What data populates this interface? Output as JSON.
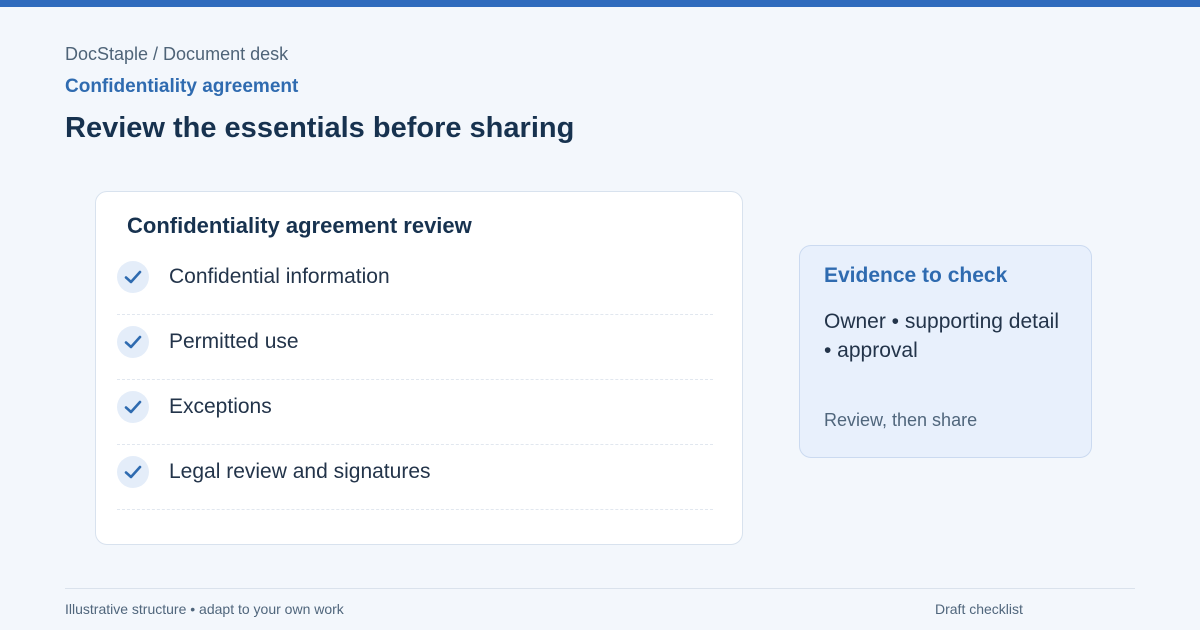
{
  "header": {
    "breadcrumb": "DocStaple / Document desk",
    "document_name": "Confidentiality agreement",
    "page_title": "Review the essentials before sharing"
  },
  "review_card": {
    "title": "Confidentiality agreement review",
    "items": [
      {
        "label": "Confidential information",
        "checked": true
      },
      {
        "label": "Permitted use",
        "checked": true
      },
      {
        "label": "Exceptions",
        "checked": true
      },
      {
        "label": "Legal review and signatures",
        "checked": true
      }
    ],
    "check_icon": "checkmark-icon"
  },
  "evidence_panel": {
    "title": "Evidence to check",
    "body": "Owner • supporting detail • approval",
    "note": "Review, then share"
  },
  "footer": {
    "left_text": "Illustrative structure • adapt to your own work",
    "right_text": "Draft checklist"
  },
  "colors": {
    "accent": "#2f6bbd",
    "background": "#f3f7fc",
    "title": "#17324f",
    "panel": "#e8f0fc"
  }
}
